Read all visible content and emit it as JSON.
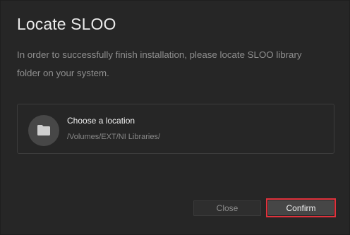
{
  "dialog": {
    "title": "Locate SLOO",
    "description": "In order to successfully finish installation, please locate SLOO library folder on your system."
  },
  "location": {
    "label": "Choose a location",
    "path": "/Volumes/EXT/NI Libraries/",
    "icon": "folder-icon"
  },
  "buttons": {
    "close_label": "Close",
    "confirm_label": "Confirm"
  },
  "colors": {
    "background": "#262626",
    "highlight": "#e0323c"
  }
}
